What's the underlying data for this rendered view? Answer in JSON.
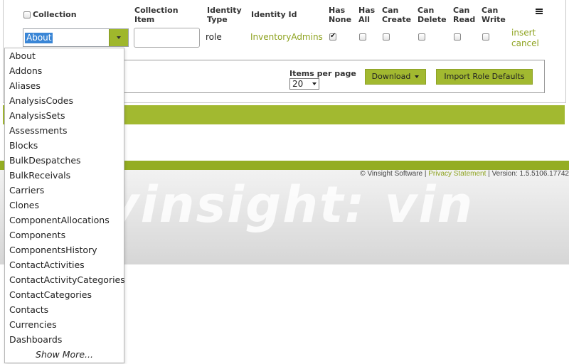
{
  "table": {
    "headers": {
      "collection": "Collection",
      "collection_item_1": "Collection",
      "collection_item_2": "Item",
      "identity_type_1": "Identity",
      "identity_type_2": "Type",
      "identity_id": "Identity Id",
      "has_none_1": "Has",
      "has_none_2": "None",
      "has_all_1": "Has",
      "has_all_2": "All",
      "can_create_1": "Can",
      "can_create_2": "Create",
      "can_delete_1": "Can",
      "can_delete_2": "Delete",
      "can_read_1": "Can",
      "can_read_2": "Read",
      "can_write_1": "Can",
      "can_write_2": "Write"
    },
    "row": {
      "collection_selected": "About",
      "collection_item_value": "",
      "identity_type": "role",
      "identity_id": "InventoryAdmins",
      "has_none": true,
      "has_all": false,
      "can_create": false,
      "can_delete": false,
      "can_read": false,
      "can_write": false,
      "insert_label": "insert",
      "cancel_label": "cancel"
    }
  },
  "pager": {
    "items_per_page_label": "Items per page",
    "items_per_page_value": "20",
    "download_label": "Download",
    "import_label": "Import Role Defaults"
  },
  "dropdown": {
    "items": [
      "About",
      "Addons",
      "Aliases",
      "AnalysisCodes",
      "AnalysisSets",
      "Assessments",
      "Blocks",
      "BulkDespatches",
      "BulkReceivals",
      "Carriers",
      "Clones",
      "ComponentAllocations",
      "Components",
      "ComponentsHistory",
      "ContactActivities",
      "ContactActivityCategories",
      "ContactCategories",
      "Contacts",
      "Currencies",
      "Dashboards"
    ],
    "show_more": "Show More..."
  },
  "footer": {
    "copyright": "© Vinsight Software",
    "sep1": " | ",
    "privacy": "Privacy Statement",
    "sep2": " | ",
    "version": "Version: 1.5.5106.17742",
    "watermark": "vinsight: vin"
  },
  "colors": {
    "accent": "#a2b930",
    "link": "#8da21e",
    "selection": "#3a86d6"
  }
}
